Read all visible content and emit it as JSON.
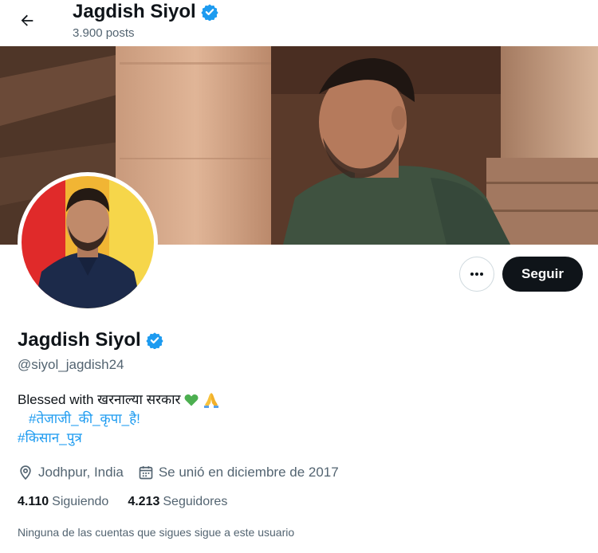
{
  "header": {
    "name": "Jagdish Siyol",
    "posts_count": "3.900 posts"
  },
  "profile": {
    "name": "Jagdish Siyol",
    "handle": "@siyol_jagdish24",
    "bio": {
      "line1_text": "Blessed with खरनाल्या सरकार",
      "hashtag1": "#तेजाजी_की_कृपा_है!",
      "hashtag2": "#किसान_पुत्र"
    },
    "location": "Jodhpur, India",
    "joined": "Se unió en diciembre de 2017",
    "following_count": "4.110",
    "following_label": "Siguiendo",
    "followers_count": "4.213",
    "followers_label": "Seguidores",
    "mutual_note": "Ninguna de las cuentas que sigues sigue a este usuario"
  },
  "actions": {
    "follow_label": "Seguir",
    "more_icon": "more-horizontal-icon"
  },
  "colors": {
    "accent": "#1d9bf0",
    "text": "#0f1419",
    "secondary": "#536471",
    "button_dark": "#0f1419"
  }
}
